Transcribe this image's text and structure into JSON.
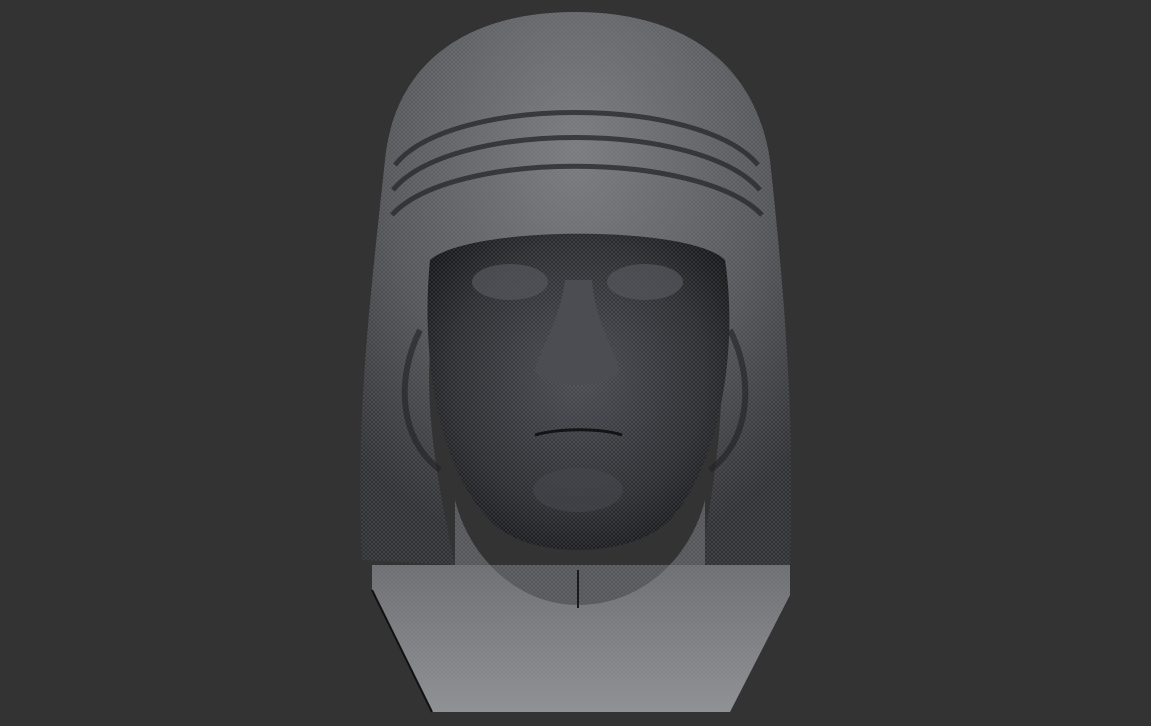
{
  "scene": {
    "subject": "bust-mesh",
    "colors": {
      "background": "#333333",
      "mesh_light": "#8a8c90",
      "mesh_mid": "#5a5c60",
      "mesh_dark": "#1e1f22"
    }
  }
}
